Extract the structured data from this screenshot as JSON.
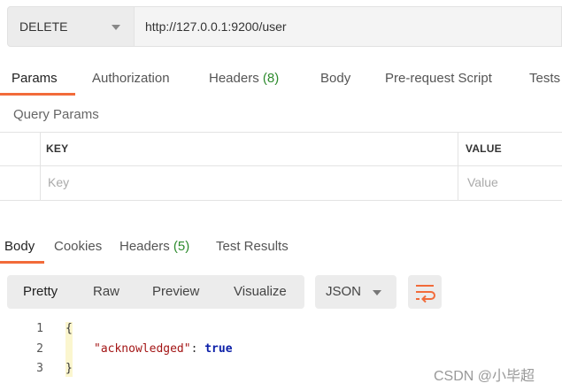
{
  "request": {
    "method": "DELETE",
    "url": "http://127.0.0.1:9200/user"
  },
  "request_tabs": {
    "params": "Params",
    "authorization": "Authorization",
    "headers": "Headers",
    "headers_count": "(8)",
    "body": "Body",
    "prerequest": "Pre-request Script",
    "tests": "Tests"
  },
  "query_params": {
    "title": "Query Params",
    "col_key": "KEY",
    "col_value": "VALUE",
    "key_placeholder": "Key",
    "value_placeholder": "Value"
  },
  "response_tabs": {
    "body": "Body",
    "cookies": "Cookies",
    "headers": "Headers",
    "headers_count": "(5)",
    "test_results": "Test Results"
  },
  "view_modes": {
    "pretty": "Pretty",
    "raw": "Raw",
    "preview": "Preview",
    "visualize": "Visualize"
  },
  "format": "JSON",
  "code": {
    "line_numbers": [
      "1",
      "2",
      "3"
    ],
    "open_brace": "{",
    "key": "\"acknowledged\"",
    "colon": ": ",
    "value": "true",
    "close_brace": "}"
  },
  "colors": {
    "accent": "#f26b3a",
    "count_green": "#2e8b2e"
  },
  "watermark": "CSDN @小毕超"
}
